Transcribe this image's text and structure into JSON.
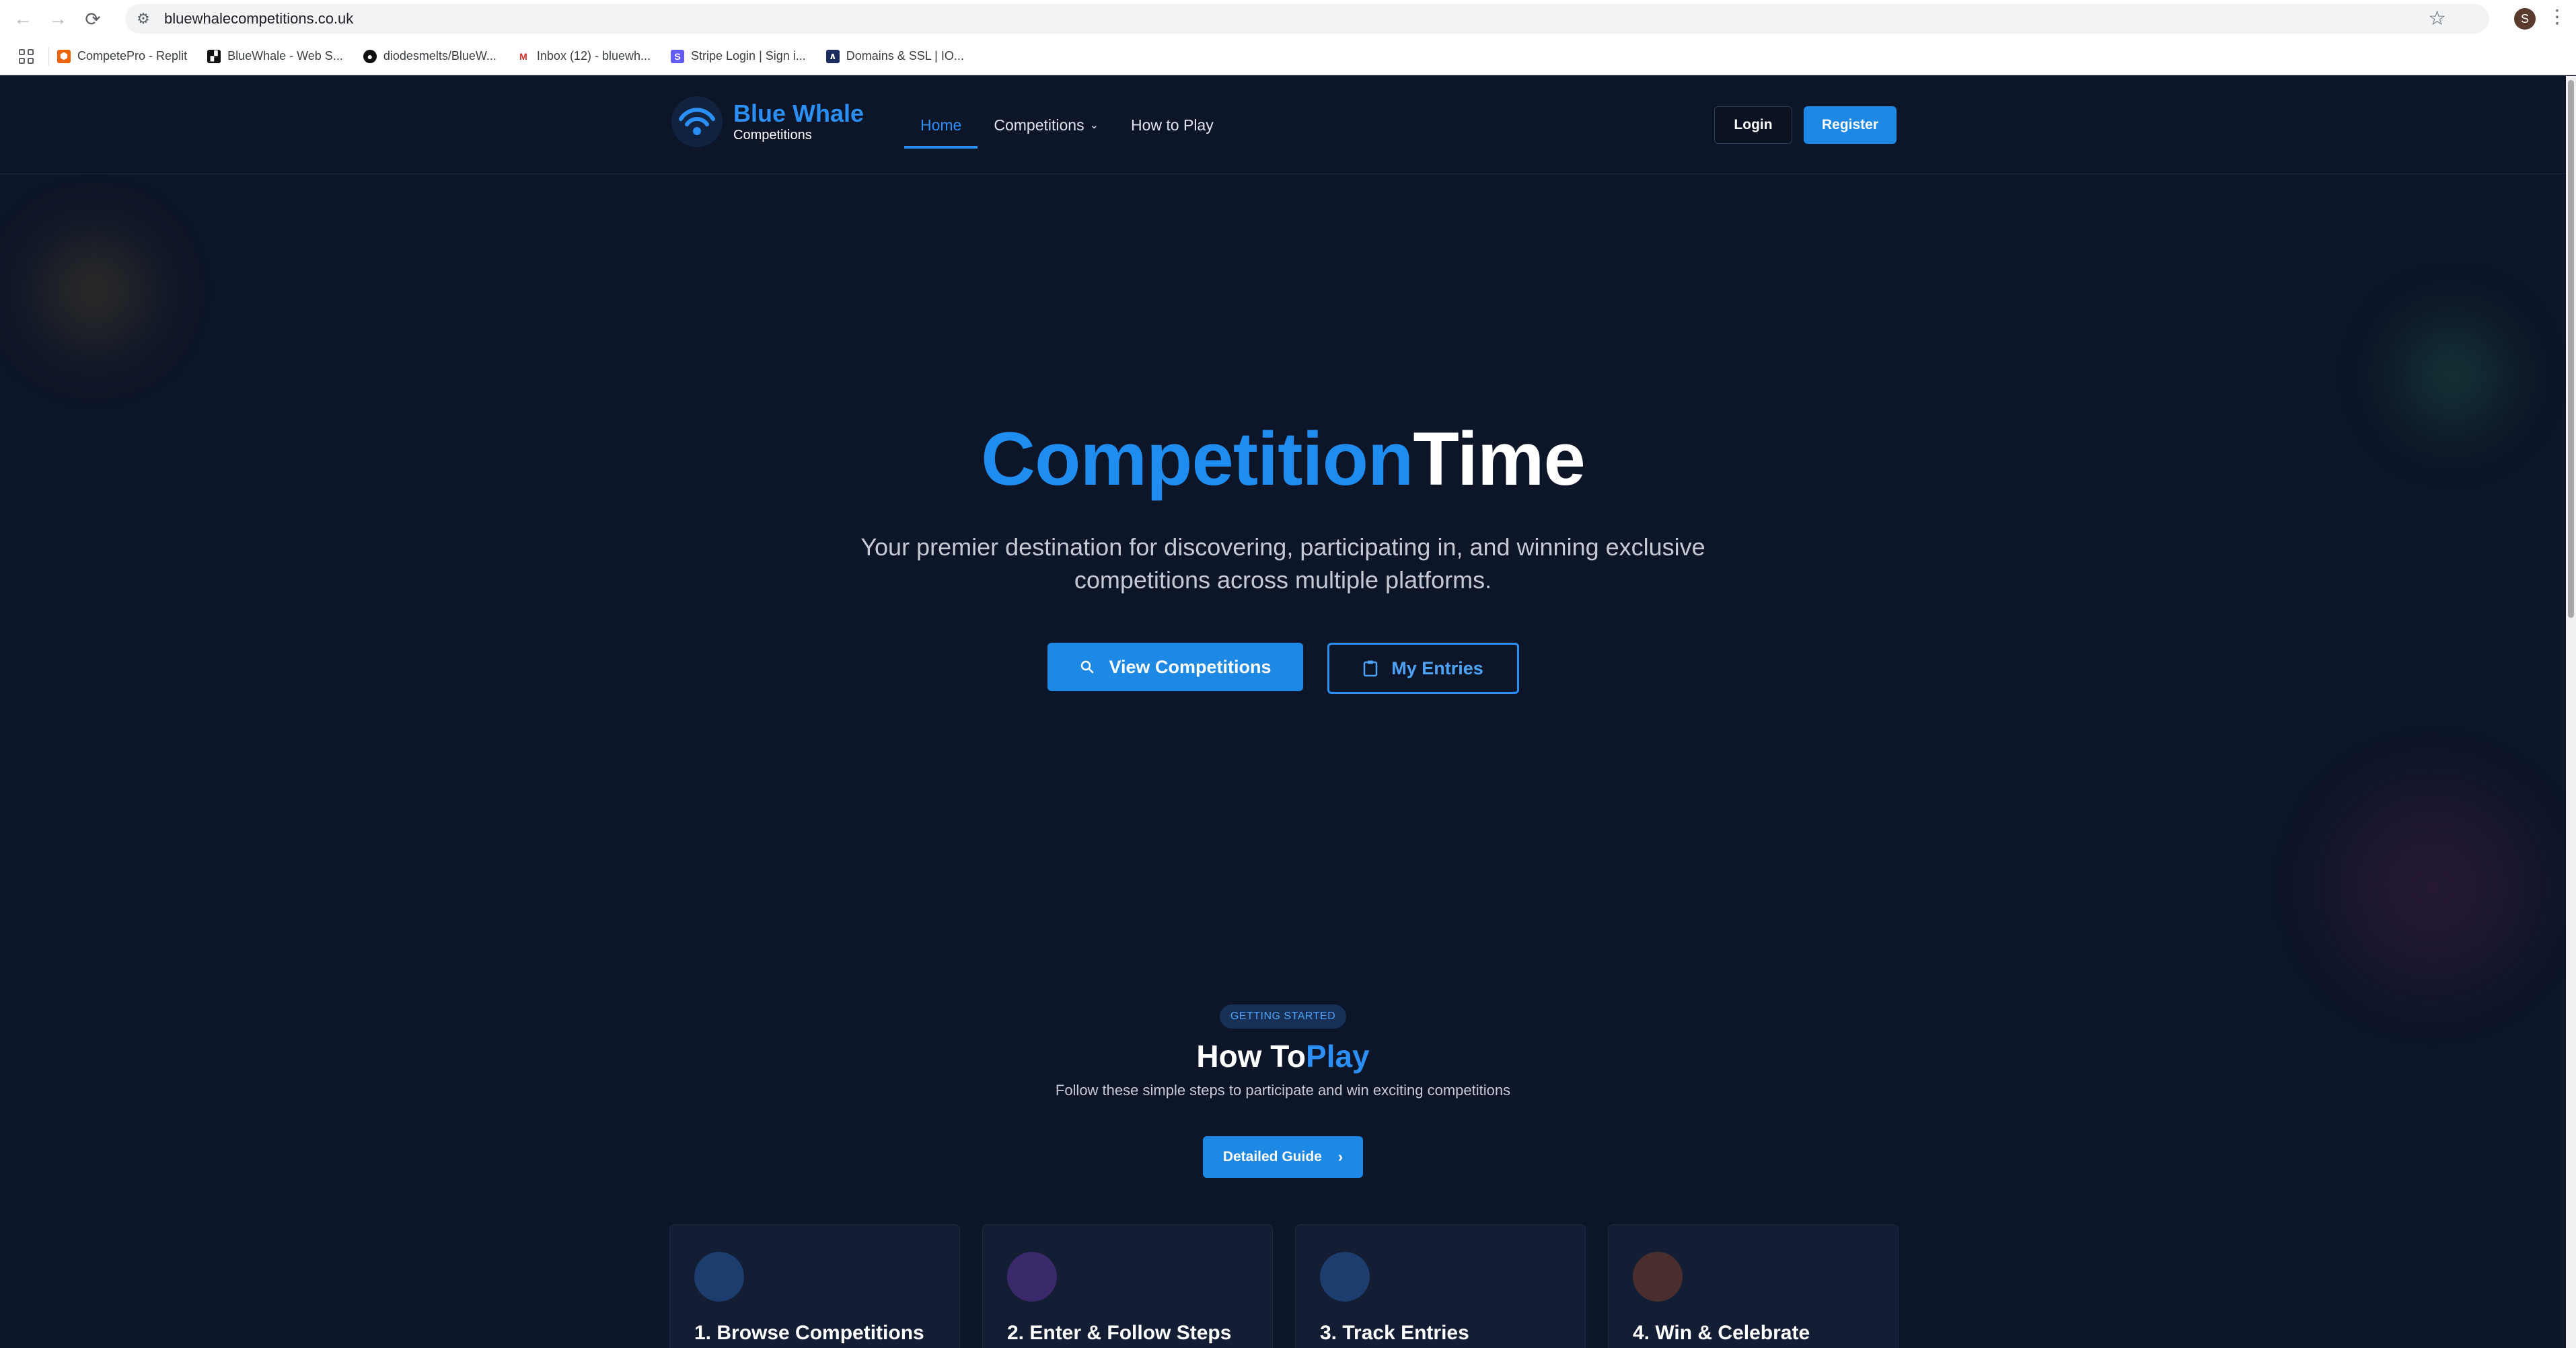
{
  "browser": {
    "url": "bluewhalecompetitions.co.uk",
    "profile_initial": "S",
    "bookmarks": [
      {
        "label": "CompetePro - Replit",
        "icon": "replit-icon",
        "color": "#f26207"
      },
      {
        "label": "BlueWhale - Web S...",
        "icon": "bluewhale-favicon-icon",
        "color": "#111111"
      },
      {
        "label": "diodesmelts/BlueW...",
        "icon": "github-icon",
        "color": "#111111"
      },
      {
        "label": "Inbox (12) - bluewh...",
        "icon": "gmail-icon",
        "color": "#d93025"
      },
      {
        "label": "Stripe Login | Sign i...",
        "icon": "stripe-icon",
        "color": "#635bff"
      },
      {
        "label": "Domains & SSL | IO...",
        "icon": "domains-icon",
        "color": "#1a2b5c"
      }
    ]
  },
  "header": {
    "brand_name": "Blue Whale",
    "brand_sub": "Competitions",
    "nav": [
      {
        "label": "Home",
        "active": true
      },
      {
        "label": "Competitions",
        "has_dropdown": true
      },
      {
        "label": "How to Play"
      }
    ],
    "login_label": "Login",
    "register_label": "Register"
  },
  "hero": {
    "title_part1": "Competition",
    "title_part2": "Time",
    "subtitle": "Your premier destination for discovering, participating in, and winning exclusive competitions across multiple platforms.",
    "primary_button": "View Competitions",
    "secondary_button": "My Entries"
  },
  "how_to_play": {
    "badge": "GETTING STARTED",
    "title_part1": "How To",
    "title_part2": "Play",
    "subtitle": "Follow these simple steps to participate and win exciting competitions",
    "guide_button": "Detailed Guide",
    "steps": [
      {
        "title": "1. Browse Competitions",
        "icon_color": "#1c3d6e"
      },
      {
        "title": "2. Enter & Follow Steps",
        "icon_color": "#3b2a6b"
      },
      {
        "title": "3. Track Entries",
        "icon_color": "#1c3d6e"
      },
      {
        "title": "4. Win & Celebrate",
        "icon_color": "#4a2e2e"
      }
    ]
  },
  "colors": {
    "accent": "#1e88e5",
    "page_bg": "#0d1528"
  }
}
